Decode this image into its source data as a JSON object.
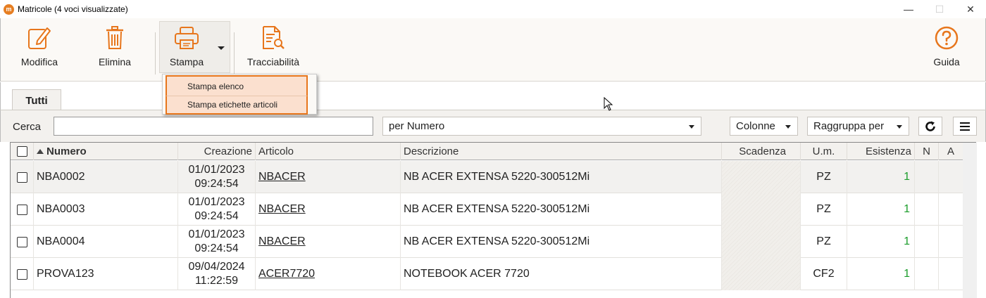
{
  "window": {
    "title": "Matricole (4 voci visualizzate)",
    "minimize": "—",
    "maximize": "☐",
    "close": "✕"
  },
  "toolbar": {
    "modifica": "Modifica",
    "elimina": "Elimina",
    "stampa": "Stampa",
    "tracciabilita": "Tracciabilità",
    "guida": "Guida",
    "accent_color": "#e7761c"
  },
  "stampa_menu": {
    "items": [
      "Stampa elenco",
      "Stampa etichette articoli"
    ]
  },
  "tabs": {
    "tutti": "Tutti"
  },
  "search": {
    "label": "Cerca",
    "value": "",
    "placeholder": "",
    "sort_by": "per Numero",
    "colonne": "Colonne",
    "raggruppa": "Raggruppa per"
  },
  "table": {
    "columns": {
      "numero": "Numero",
      "creazione": "Creazione",
      "articolo": "Articolo",
      "descrizione": "Descrizione",
      "scadenza": "Scadenza",
      "um": "U.m.",
      "esistenza": "Esistenza",
      "n": "N",
      "a": "A"
    },
    "rows": [
      {
        "numero": "NBA0002",
        "data": "01/01/2023",
        "ora": "09:24:54",
        "articolo": "NBACER",
        "descrizione": "NB ACER EXTENSA 5220-300512Mi",
        "scadenza": "",
        "um": "PZ",
        "esistenza": "1"
      },
      {
        "numero": "NBA0003",
        "data": "01/01/2023",
        "ora": "09:24:54",
        "articolo": "NBACER",
        "descrizione": "NB ACER EXTENSA 5220-300512Mi",
        "scadenza": "",
        "um": "PZ",
        "esistenza": "1"
      },
      {
        "numero": "NBA0004",
        "data": "01/01/2023",
        "ora": "09:24:54",
        "articolo": "NBACER",
        "descrizione": "NB ACER EXTENSA 5220-300512Mi",
        "scadenza": "",
        "um": "PZ",
        "esistenza": "1"
      },
      {
        "numero": "PROVA123",
        "data": "09/04/2024",
        "ora": "11:22:59",
        "articolo": "ACER7720",
        "descrizione": "NOTEBOOK ACER 7720",
        "scadenza": "",
        "um": "CF2",
        "esistenza": "1"
      }
    ]
  }
}
